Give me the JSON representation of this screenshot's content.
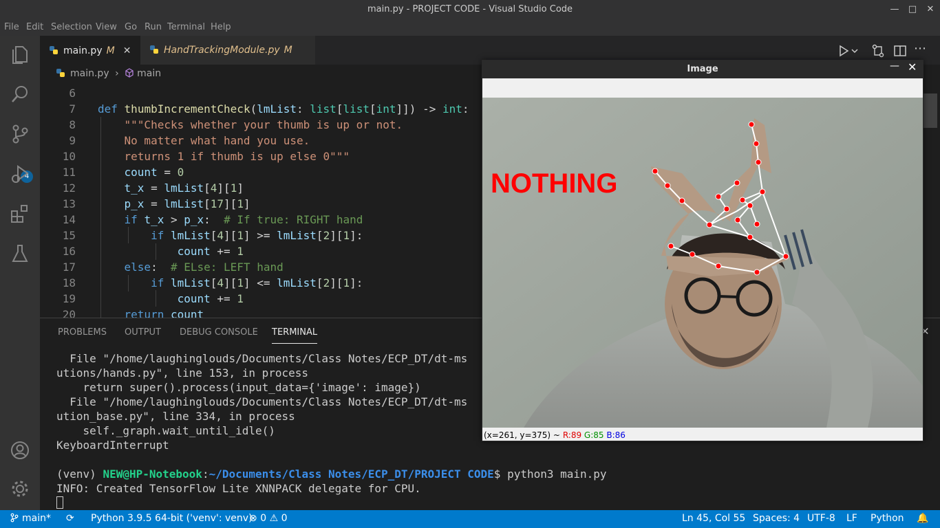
{
  "window": {
    "title": "main.py - PROJECT CODE - Visual Studio Code"
  },
  "menu": [
    "File",
    "Edit",
    "Selection",
    "View",
    "Go",
    "Run",
    "Terminal",
    "Help"
  ],
  "activity": {
    "scm_badge": "4"
  },
  "tabs": [
    {
      "label": "main.py",
      "status": "M"
    },
    {
      "label": "HandTrackingModule.py",
      "status": "M"
    }
  ],
  "breadcrumb": {
    "file": "main.py",
    "symbol": "main"
  },
  "editor": {
    "line_numbers": [
      "6",
      "7",
      "8",
      "9",
      "10",
      "11",
      "12",
      "13",
      "14",
      "15",
      "16",
      "17",
      "18",
      "19",
      "20"
    ]
  },
  "panel": {
    "tabs": [
      "PROBLEMS",
      "OUTPUT",
      "DEBUG CONSOLE",
      "TERMINAL"
    ],
    "terminal": {
      "lines": [
        "  File \"/home/laughinglouds/Documents/Class Notes/ECP_DT/dt-ms",
        "utions/hands.py\", line 153, in process",
        "    return super().process(input_data={'image': image})",
        "  File \"/home/laughinglouds/Documents/Class Notes/ECP_DT/dt-ms",
        "ution_base.py\", line 334, in process",
        "    self._graph.wait_until_idle()",
        "KeyboardInterrupt",
        ""
      ],
      "prompt_venv": "(venv) ",
      "prompt_user": "NEW@HP-Notebook",
      "prompt_colon": ":",
      "prompt_path": "~/Documents/Class Notes/ECP_DT/PROJECT CODE",
      "prompt_cmd": "$ python3 main.py",
      "info_line": "INFO: Created TensorFlow Lite XNNPACK delegate for CPU."
    }
  },
  "status": {
    "branch": "main*",
    "interpreter": "Python 3.9.5 64-bit ('venv': venv)",
    "errors": "0",
    "warnings": "0",
    "position": "Ln 45, Col 55",
    "spaces": "Spaces: 4",
    "encoding": "UTF-8",
    "eol": "LF",
    "language": "Python"
  },
  "image_window": {
    "title": "Image",
    "overlay_text": "NOTHING",
    "status_coords": "(x=261, y=375) ~",
    "r": "R:89",
    "g": "G:85",
    "b": "B:86"
  }
}
